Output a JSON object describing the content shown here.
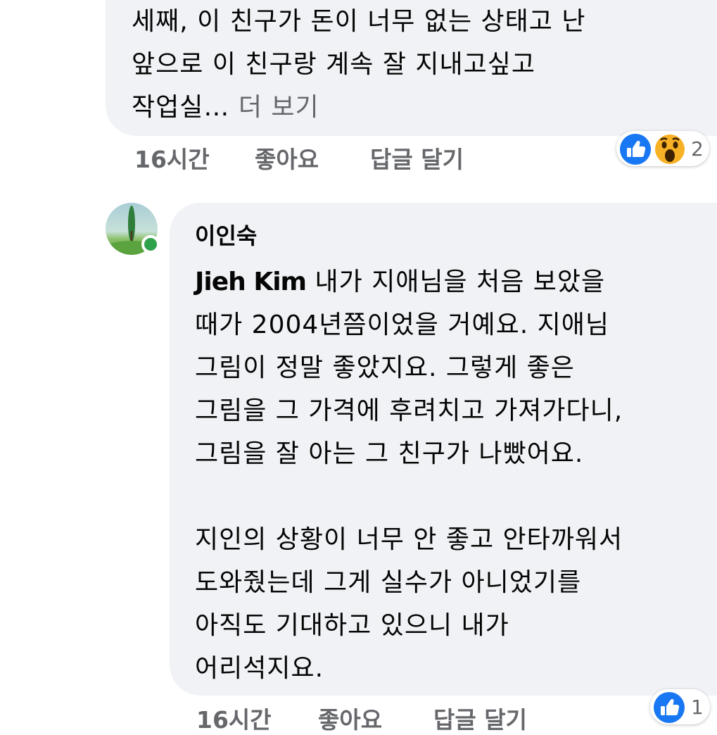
{
  "comment1": {
    "text_lines": "세째, 이 친구가 돈이 너무 없는 상태고 난\n앞으로 이 친구랑 계속 잘 지내고싶고\n작업실…",
    "see_more": "더 보기",
    "time": "16시간",
    "like_label": "좋아요",
    "reply_label": "답글 달기",
    "reaction_icons": [
      "like-icon",
      "wow-icon"
    ],
    "reaction_count": "2"
  },
  "comment2": {
    "author": "이인숙",
    "mention": "Jieh Kim",
    "text": " 내가 지애님을 처음 보았을\n때가 2004년쯤이었을 거예요. 지애님\n그림이 정말 좋았지요. 그렇게 좋은\n그림을 그 가격에 후려치고 가져가다니,\n그림을 잘 아는 그 친구가 나빴어요.\n\n지인의 상황이 너무 안 좋고 안타까워서\n도와줬는데 그게 실수가 아니었기를\n아직도 기대하고 있으니 내가\n어리석지요.",
    "time": "16시간",
    "like_label": "좋아요",
    "reply_label": "답글 달기",
    "reaction_icons": [
      "like-icon"
    ],
    "reaction_count": "1"
  },
  "colors": {
    "bubble": "#f0f2f5",
    "meta_text": "#65676b",
    "like_blue": "#1877f2",
    "online_green": "#31a24c"
  }
}
